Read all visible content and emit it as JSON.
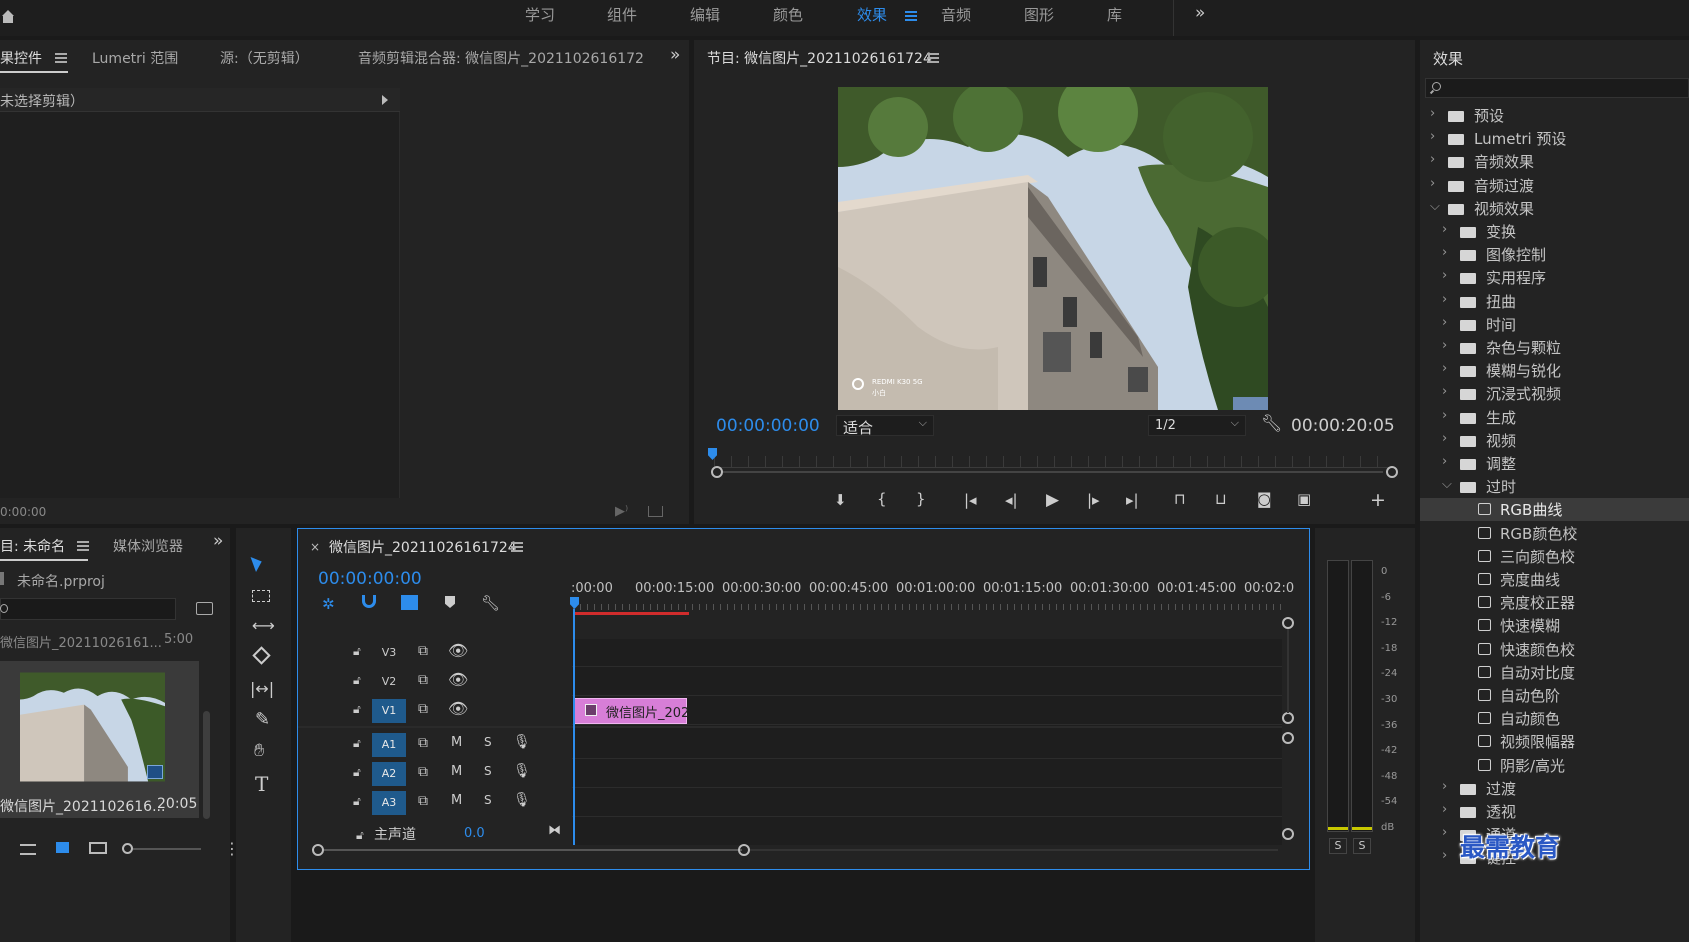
{
  "workspace_tabs": [
    {
      "label": "学习"
    },
    {
      "label": "组件"
    },
    {
      "label": "编辑"
    },
    {
      "label": "颜色"
    },
    {
      "label": "效果",
      "active": true
    },
    {
      "label": "音频"
    },
    {
      "label": "图形"
    },
    {
      "label": "库"
    }
  ],
  "effect_controls_panel": {
    "tabs": [
      "果控件",
      "Lumetri 范围",
      "源:（无剪辑）",
      "音频剪辑混合器: 微信图片_2021102616172"
    ],
    "no_clip_label": "未选择剪辑）",
    "timecode": "0:00:00"
  },
  "program_monitor": {
    "title": "节目: 微信图片_20211026161724",
    "timecode": "00:00:00:00",
    "fit_option": "适合",
    "resolution": "1/2",
    "duration": "00:00:20:05",
    "watermark_line1": "REDMI K30 5G",
    "watermark_line2": "小白"
  },
  "effects_panel": {
    "title": "效果",
    "tree": [
      {
        "label": "预设",
        "level": 0,
        "expanded": false,
        "icon": "preset-folder"
      },
      {
        "label": "Lumetri 预设",
        "level": 0,
        "expanded": false,
        "icon": "preset-folder"
      },
      {
        "label": "音频效果",
        "level": 0,
        "expanded": false,
        "icon": "folder"
      },
      {
        "label": "音频过渡",
        "level": 0,
        "expanded": false,
        "icon": "folder"
      },
      {
        "label": "视频效果",
        "level": 0,
        "expanded": true,
        "icon": "folder"
      },
      {
        "label": "变换",
        "level": 1,
        "expanded": false,
        "icon": "folder"
      },
      {
        "label": "图像控制",
        "level": 1,
        "expanded": false,
        "icon": "folder"
      },
      {
        "label": "实用程序",
        "level": 1,
        "expanded": false,
        "icon": "folder"
      },
      {
        "label": "扭曲",
        "level": 1,
        "expanded": false,
        "icon": "folder"
      },
      {
        "label": "时间",
        "level": 1,
        "expanded": false,
        "icon": "folder"
      },
      {
        "label": "杂色与颗粒",
        "level": 1,
        "expanded": false,
        "icon": "folder"
      },
      {
        "label": "模糊与锐化",
        "level": 1,
        "expanded": false,
        "icon": "folder"
      },
      {
        "label": "沉浸式视频",
        "level": 1,
        "expanded": false,
        "icon": "folder"
      },
      {
        "label": "生成",
        "level": 1,
        "expanded": false,
        "icon": "folder"
      },
      {
        "label": "视频",
        "level": 1,
        "expanded": false,
        "icon": "folder"
      },
      {
        "label": "调整",
        "level": 1,
        "expanded": false,
        "icon": "folder"
      },
      {
        "label": "过时",
        "level": 1,
        "expanded": true,
        "icon": "folder"
      },
      {
        "label": "RGB曲线",
        "level": 2,
        "icon": "effect",
        "selected": true
      },
      {
        "label": "RGB颜色校",
        "level": 2,
        "icon": "effect"
      },
      {
        "label": "三向颜色校",
        "level": 2,
        "icon": "effect"
      },
      {
        "label": "亮度曲线",
        "level": 2,
        "icon": "effect"
      },
      {
        "label": "亮度校正器",
        "level": 2,
        "icon": "effect"
      },
      {
        "label": "快速模糊",
        "level": 2,
        "icon": "effect"
      },
      {
        "label": "快速颜色校",
        "level": 2,
        "icon": "effect"
      },
      {
        "label": "自动对比度",
        "level": 2,
        "icon": "effect"
      },
      {
        "label": "自动色阶",
        "level": 2,
        "icon": "effect"
      },
      {
        "label": "自动颜色",
        "level": 2,
        "icon": "effect"
      },
      {
        "label": "视频限幅器",
        "level": 2,
        "icon": "effect"
      },
      {
        "label": "阴影/高光",
        "level": 2,
        "icon": "effect"
      },
      {
        "label": "过渡",
        "level": 1,
        "expanded": false,
        "icon": "folder"
      },
      {
        "label": "透视",
        "level": 1,
        "expanded": false,
        "icon": "folder"
      },
      {
        "label": "通道",
        "level": 1,
        "expanded": false,
        "icon": "folder"
      },
      {
        "label": "键控",
        "level": 1,
        "expanded": false,
        "icon": "folder"
      }
    ]
  },
  "project_panel": {
    "tabs": [
      "目: 未命名",
      "媒体浏览器"
    ],
    "project_file": "未命名.prproj",
    "list_header": "微信图片_20211026161...",
    "list_header_duration": "5:00",
    "clip_name": "微信图片_2021102616...",
    "clip_duration": "20:05"
  },
  "timeline": {
    "title": "微信图片_20211026161724",
    "timecode": "00:00:00:00",
    "ruler": [
      ":00:00",
      "00:00:15:00",
      "00:00:30:00",
      "00:00:45:00",
      "00:01:00:00",
      "00:01:15:00",
      "00:01:30:00",
      "00:01:45:00",
      "00:02:0"
    ],
    "video_tracks": [
      "V3",
      "V2",
      "V1"
    ],
    "audio_tracks": [
      "A1",
      "A2",
      "A3"
    ],
    "mute_label": "M",
    "solo_label": "S",
    "master_label": "主声道",
    "master_value": "0.0",
    "clip_label": "微信图片_202"
  },
  "audio_meter": {
    "scale": [
      "0",
      "-6",
      "-12",
      "-18",
      "-24",
      "-30",
      "-36",
      "-42",
      "-48",
      "-54",
      "dB"
    ],
    "solo_left": "S",
    "solo_right": "S"
  },
  "watermark": "最需教育",
  "colors": {
    "accent": "#2d8ceb",
    "clip": "#d77ed7",
    "track_on": "#1f5a8c",
    "work_area": "#d02c2c"
  }
}
